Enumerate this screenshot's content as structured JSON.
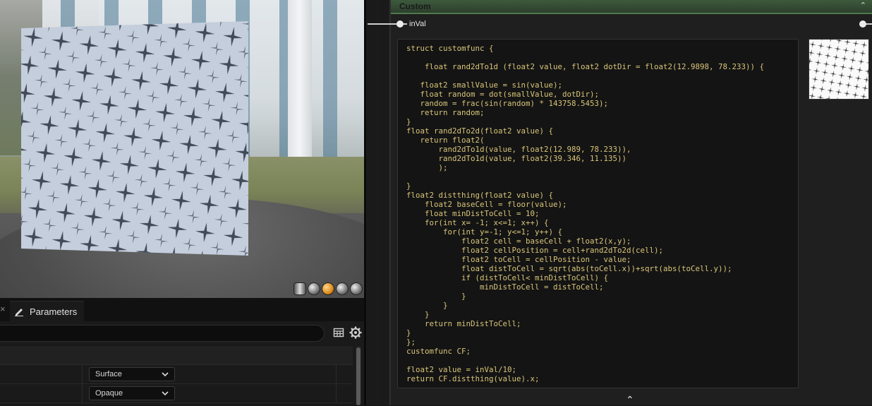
{
  "viewport": {
    "preview_mode_icons": [
      "cylinder-preview-icon",
      "sphere-preview-icon",
      "plane-preview-icon",
      "cube-preview-icon",
      "custom-mesh-preview-icon"
    ]
  },
  "details": {
    "tab_label": "Parameters",
    "rows": [
      {
        "value": "Surface"
      },
      {
        "value": "Opaque"
      }
    ]
  },
  "node": {
    "title": "Custom",
    "input_pin": "inVal",
    "code": "struct customfunc {\n\n    float rand2dTo1d (float2 value, float2 dotDir = float2(12.9898, 78.233)) {\n\n   float2 smallValue = sin(value);\n   float random = dot(smallValue, dotDir);\n   random = frac(sin(random) * 143758.5453);\n   return random;\n}\nfloat rand2dTo2d(float2 value) {\n   return float2(\n       rand2dTo1d(value, float2(12.989, 78.233)),\n       rand2dTo1d(value, float2(39.346, 11.135))\n       );\n\n}\nfloat2 distthing(float2 value) {\n    float2 baseCell = floor(value);\n    float minDistToCell = 10;\n    for(int x= -1; x<=1; x++) {\n        for(int y=-1; y<=1; y++) {\n            float2 cell = baseCell + float2(x,y);\n            float2 cellPosition = cell+rand2dTo2d(cell);\n            float2 toCell = cellPosition - value;\n            float distToCell = sqrt(abs(toCell.x))+sqrt(abs(toCell.y));\n            if (distToCell< minDistToCell) {\n                minDistToCell = distToCell;\n            }\n        }\n    }\n    return minDistToCell;\n}\n};\ncustomfunc CF;\n\nfloat2 value = inVal/10;\nreturn CF.distthing(value).x;"
  }
}
